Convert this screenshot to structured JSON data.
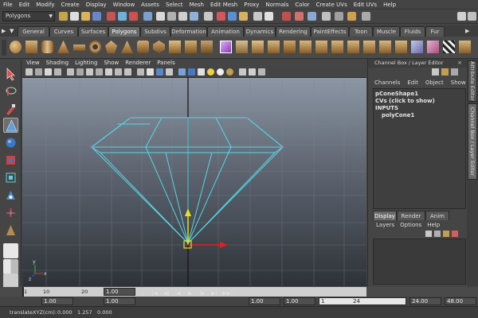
{
  "menubar": [
    "File",
    "Edit",
    "Modify",
    "Create",
    "Display",
    "Window",
    "Assets",
    "Select",
    "Mesh",
    "Edit Mesh",
    "Proxy",
    "Normals",
    "Color",
    "Create UVs",
    "Edit UVs",
    "Help"
  ],
  "mode_selector": "Polygons",
  "shelf_tabs": [
    {
      "label": "General",
      "active": false
    },
    {
      "label": "Curves",
      "active": false
    },
    {
      "label": "Surfaces",
      "active": false
    },
    {
      "label": "Polygons",
      "active": true
    },
    {
      "label": "Subdivs",
      "active": false
    },
    {
      "label": "Deformation",
      "active": false
    },
    {
      "label": "Animation",
      "active": false
    },
    {
      "label": "Dynamics",
      "active": false
    },
    {
      "label": "Rendering",
      "active": false
    },
    {
      "label": "PaintEffects",
      "active": false
    },
    {
      "label": "Toon",
      "active": false
    },
    {
      "label": "Muscle",
      "active": false
    },
    {
      "label": "Fluids",
      "active": false
    },
    {
      "label": "Fur",
      "active": false
    }
  ],
  "viewport_menu": [
    "View",
    "Shading",
    "Lighting",
    "Show",
    "Renderer",
    "Panels"
  ],
  "channel_box": {
    "title": "Channel Box / Layer Editor",
    "menu": [
      "Channels",
      "Edit",
      "Object",
      "Show"
    ],
    "lines": [
      "pConeShape1",
      "CVs (click to show)",
      "INPUTS",
      "polyCone1"
    ]
  },
  "layer_editor": {
    "tabs": [
      {
        "label": "Display",
        "active": true
      },
      {
        "label": "Render",
        "active": false
      },
      {
        "label": "Anim",
        "active": false
      }
    ],
    "menu": [
      "Layers",
      "Options",
      "Help"
    ]
  },
  "side_tabs": [
    "Attribute Editor",
    "Channel Box / Layer Editor"
  ],
  "time_slider": {
    "ticks": [
      "1",
      "10",
      "20"
    ],
    "current_frame": "1.00"
  },
  "range": {
    "start": "1.00",
    "anim_start": "1.00",
    "range_start": "1.00",
    "range_slider_start": "1",
    "range_slider_end": "24",
    "range_end": "24.00",
    "anim_end": "48.00"
  },
  "playback_glyphs": [
    "|◀◀",
    "|◀",
    "◀|",
    "◀",
    "▶",
    "|▶",
    "▶|",
    "▶▶|"
  ],
  "command_line": {
    "text": "translateXYZ(cm):",
    "values": [
      "0.000",
      "1.257",
      "0.000"
    ]
  },
  "viewport": {
    "axis_x_label": "x",
    "axis_y_label": "y",
    "axis_z_label": "z"
  },
  "colors": {
    "wireframe": "#55d6e6",
    "viewport_top": "#8c96a4",
    "viewport_bottom": "#2e3238"
  }
}
